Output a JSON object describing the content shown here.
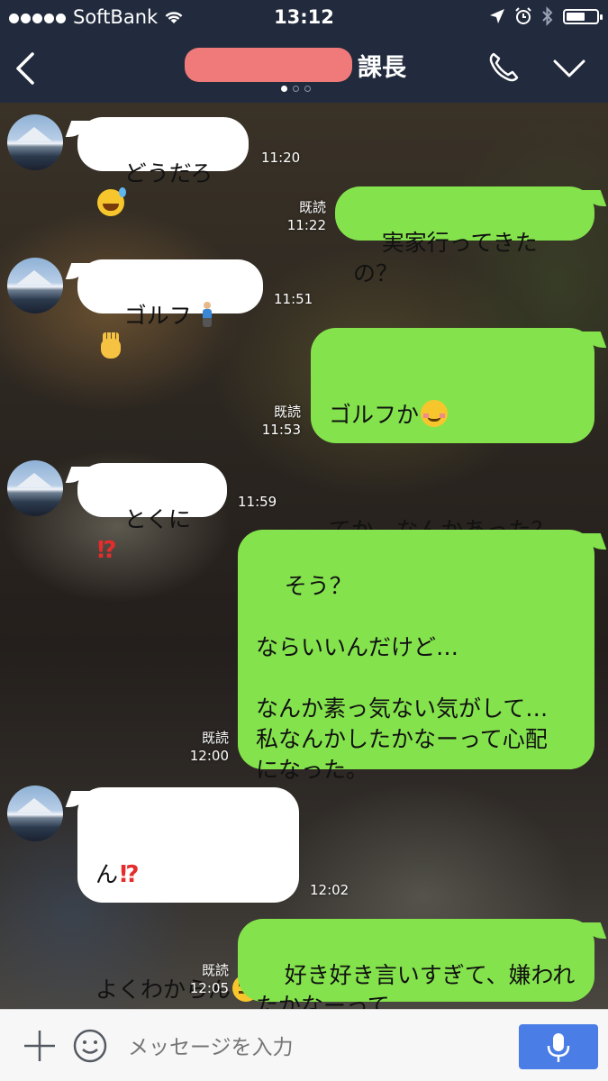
{
  "status_bar": {
    "carrier": "SoftBank",
    "time": "13:12",
    "signal_bars": 5,
    "battery_level": 0.55
  },
  "header": {
    "title_suffix": "課長",
    "page_count": 3,
    "active_page": 1
  },
  "messages": [
    {
      "side": "in",
      "text": "どうだろ",
      "emoji": "sweat-smile-emoji",
      "time": "11:20"
    },
    {
      "side": "out",
      "text": "実家行ってきたの？",
      "read": "既読",
      "time": "11:22"
    },
    {
      "side": "in",
      "text": "ゴルフ",
      "emoji": "golfer-emoji raised-hand-emoji",
      "time": "11:51"
    },
    {
      "side": "out",
      "text": "ゴルフか",
      "text2": "てか、なんかあった？",
      "emoji": "blush-emoji",
      "read": "既読",
      "time": "11:53"
    },
    {
      "side": "in",
      "text": "とくに",
      "emoji": "interrobang-emoji",
      "time": "11:59"
    },
    {
      "side": "out",
      "text": "そう？\n\nならいいんだけど…\n\nなんか素っ気ない気がして…\n私なんかしたかなーって心配\nになった。",
      "read": "既読",
      "time": "12:00"
    },
    {
      "side": "in",
      "text": "ん",
      "text2": "よくわからん",
      "emoji": "interrobang-emoji expressionless-emoji",
      "time": "12:02"
    },
    {
      "side": "out",
      "text": "好き好き言いすぎて、嫌われ\nたかなーって…",
      "read": "既読",
      "time": "12:05"
    }
  ],
  "input": {
    "placeholder": "メッセージを入力"
  },
  "colors": {
    "bar": "#222b3d",
    "outgoing_bubble": "#84e34c",
    "incoming_bubble": "#ffffff",
    "mic_button": "#4a7ee6"
  }
}
